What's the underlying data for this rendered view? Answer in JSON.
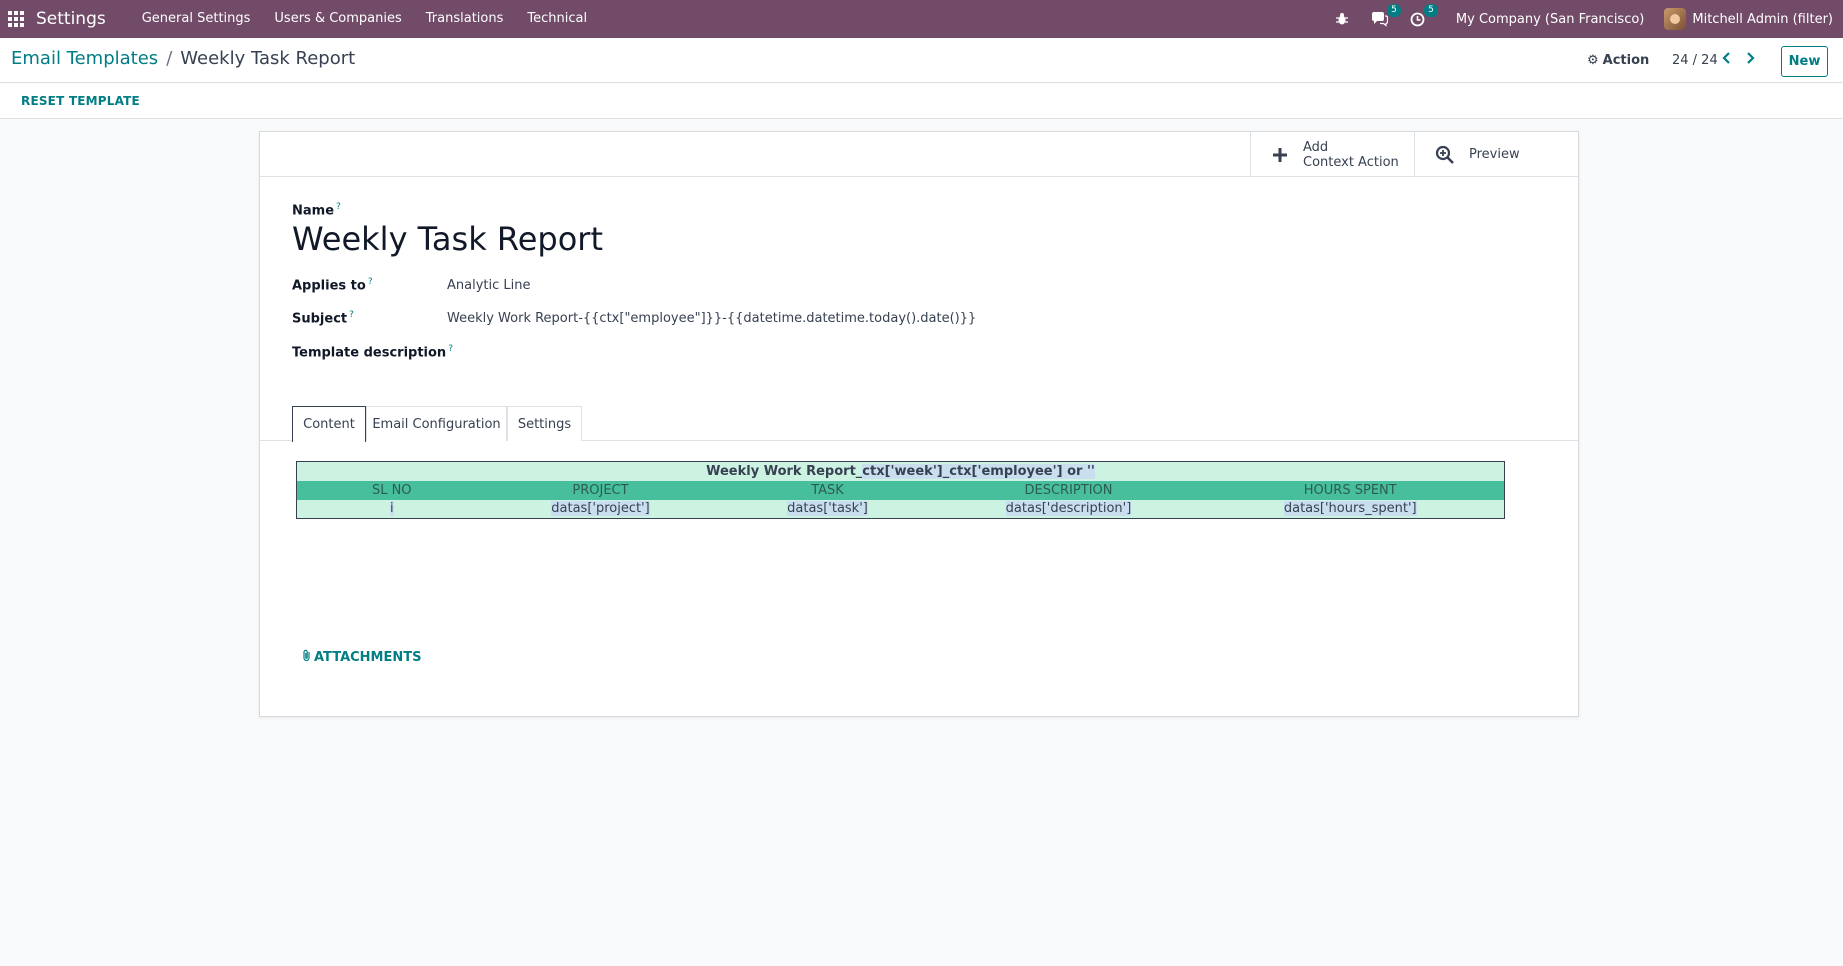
{
  "navbar": {
    "app_name": "Settings",
    "menu": [
      "General Settings",
      "Users & Companies",
      "Translations",
      "Technical"
    ],
    "messages_badge": "5",
    "activities_badge": "5",
    "company": "My Company (San Francisco)",
    "user": "Mitchell Admin (filter)"
  },
  "control_panel": {
    "breadcrumb_parent": "Email Templates",
    "breadcrumb_separator": "/",
    "breadcrumb_current": "Weekly Task Report",
    "action_label": "Action",
    "pager": "24 / 24",
    "new_label": "New"
  },
  "statusbar": {
    "reset_label": "RESET TEMPLATE"
  },
  "smart_buttons": {
    "context_action_line1": "Add",
    "context_action_line2": "Context Action",
    "preview": "Preview"
  },
  "form": {
    "name_label": "Name",
    "name_value": "Weekly Task Report",
    "applies_to_label": "Applies to",
    "applies_to_value": "Analytic Line",
    "subject_label": "Subject",
    "subject_value": "Weekly Work Report-{{ctx[\"employee\"]}}-{{datetime.datetime.today().date()}}",
    "description_label": "Template description",
    "help_mark": "?"
  },
  "tabs": [
    "Content",
    "Email Configuration",
    "Settings"
  ],
  "content_table": {
    "title_prefix": "Weekly Work Report_",
    "title_highlight": "ctx['week']_ctx['employee'] or ''",
    "headers": [
      "SL NO",
      "PROJECT",
      "TASK",
      "DESCRIPTION",
      "HOURS SPENT"
    ],
    "row": [
      "i",
      "datas['project']",
      "datas['task']",
      "datas['description']",
      "datas['hours_spent']"
    ]
  },
  "attachments_label": "ATTACHMENTS",
  "colors": {
    "navbar": "#714b67",
    "accent": "#017e84",
    "table_light": "#ccf2e2",
    "table_header": "#48bf9c"
  }
}
